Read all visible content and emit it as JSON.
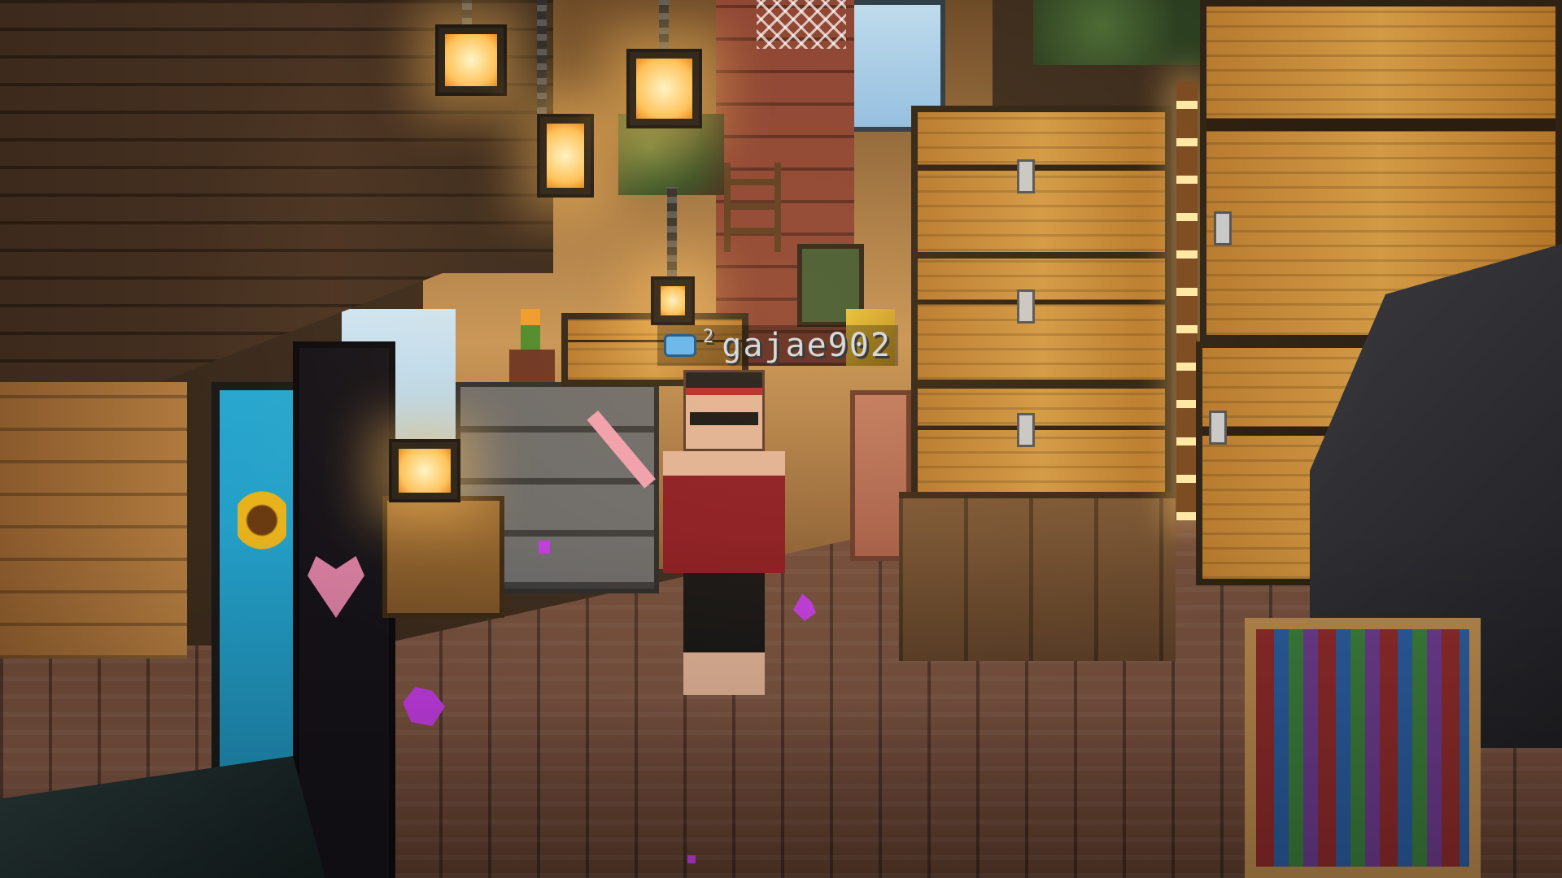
{
  "player": {
    "name": "gajae902",
    "level": "2",
    "badge_icon": "diving-mask-icon"
  },
  "colors": {
    "particle": "#c23ce2",
    "lantern_glow": "#ffc35a"
  }
}
